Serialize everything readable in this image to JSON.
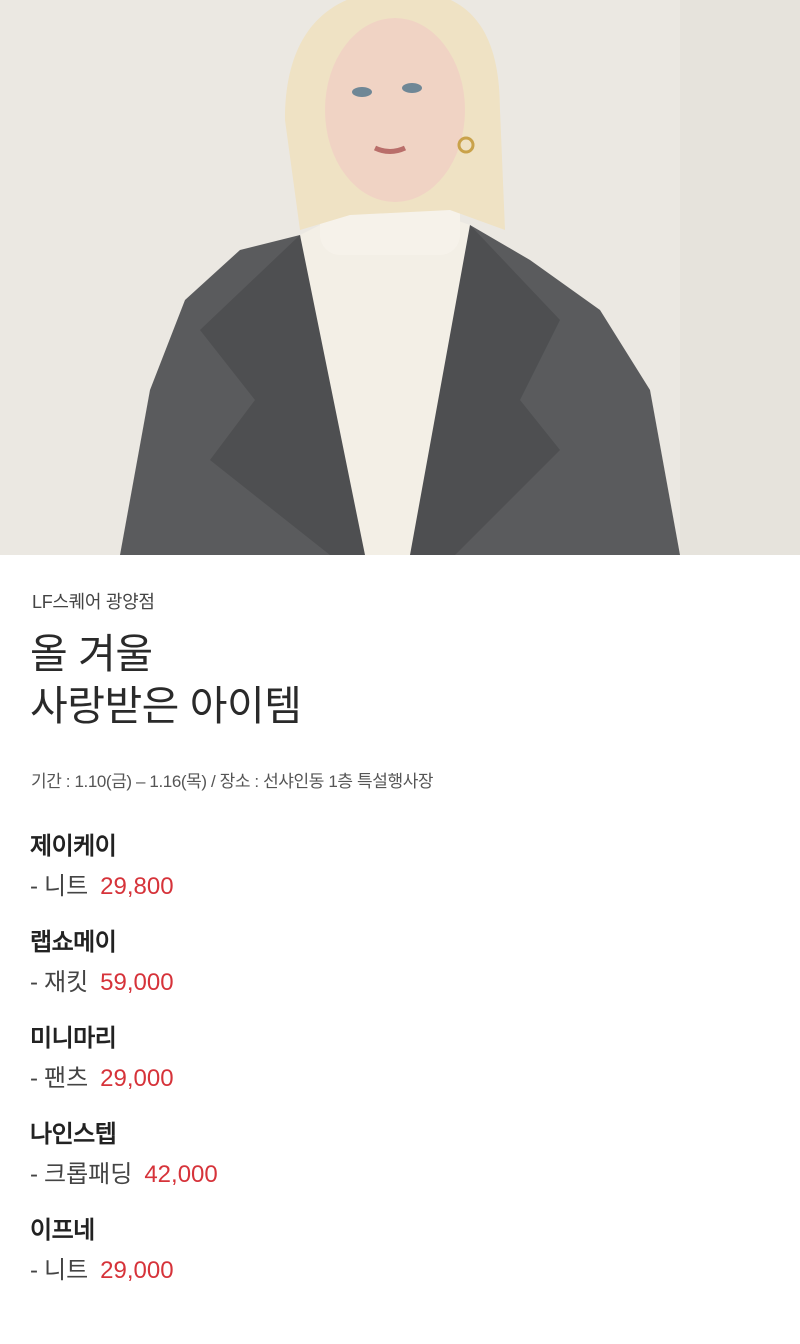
{
  "hero": {
    "image_description": "model-in-grey-coat-photo",
    "colors": {
      "background": "#ebe8e2",
      "coat": "#5a5b5d",
      "sweater": "#f3efe6",
      "hair": "#efe2c4"
    }
  },
  "store_name": "LF스퀘어 광양점",
  "headline": {
    "line1": "올 겨울",
    "line2": "사랑받은 아이템"
  },
  "period": "기간 : 1.10(금) – 1.16(목) / 장소 : 선샤인동 1층 특설행사장",
  "items": [
    {
      "brand": "제이케이",
      "dash": "-",
      "product": "니트",
      "price": "29,800"
    },
    {
      "brand": "랩쇼메이",
      "dash": "-",
      "product": "재킷",
      "price": "59,000"
    },
    {
      "brand": "미니마리",
      "dash": "-",
      "product": "팬츠",
      "price": "29,000"
    },
    {
      "brand": "나인스텝",
      "dash": "-",
      "product": "크롭패딩",
      "price": "42,000"
    },
    {
      "brand": "이프네",
      "dash": "-",
      "product": "니트",
      "price": "29,000"
    }
  ],
  "price_color": "#d6333a"
}
